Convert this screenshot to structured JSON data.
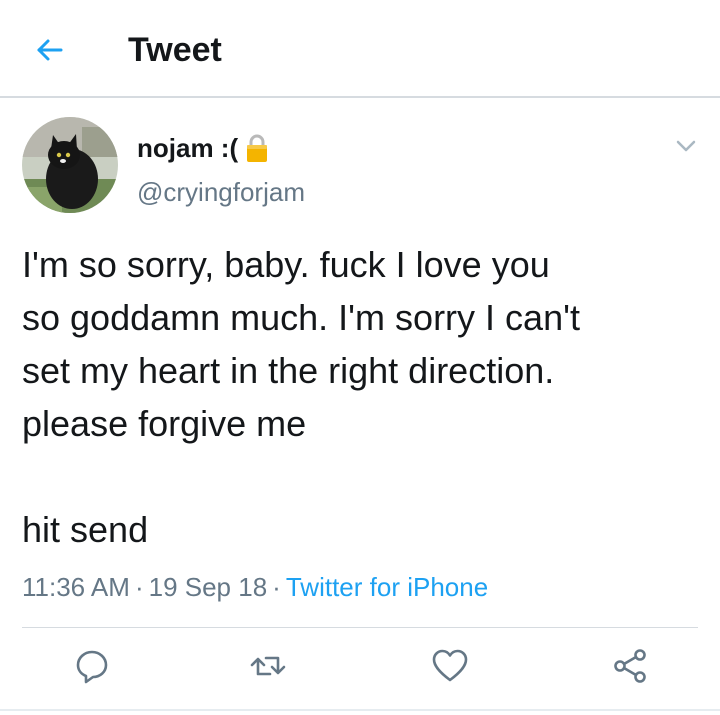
{
  "header": {
    "back_icon": "arrow-left-icon",
    "title": "Tweet"
  },
  "tweet": {
    "author": {
      "display_name": "nojam :(",
      "handle": "@cryingforjam",
      "avatar_icon": "black-cat-avatar",
      "badge_icon": "lock-icon"
    },
    "menu_icon": "chevron-down-icon",
    "text": "I'm so sorry, baby. fuck I love you\nso goddamn much. I'm sorry I can't\nset my heart in the right direction.\nplease forgive me\n\nhit send",
    "time": "11:36 AM",
    "separator": "·",
    "date": "19 Sep 18",
    "source": "Twitter for iPhone"
  },
  "actions": [
    {
      "icon": "reply-icon"
    },
    {
      "icon": "retweet-icon"
    },
    {
      "icon": "like-icon"
    },
    {
      "icon": "share-icon"
    }
  ],
  "colors": {
    "accent": "#1da1f2",
    "text_primary": "#14171a",
    "text_secondary": "#657786",
    "divider": "#d6dbe0",
    "icon_gray": "#657786"
  }
}
